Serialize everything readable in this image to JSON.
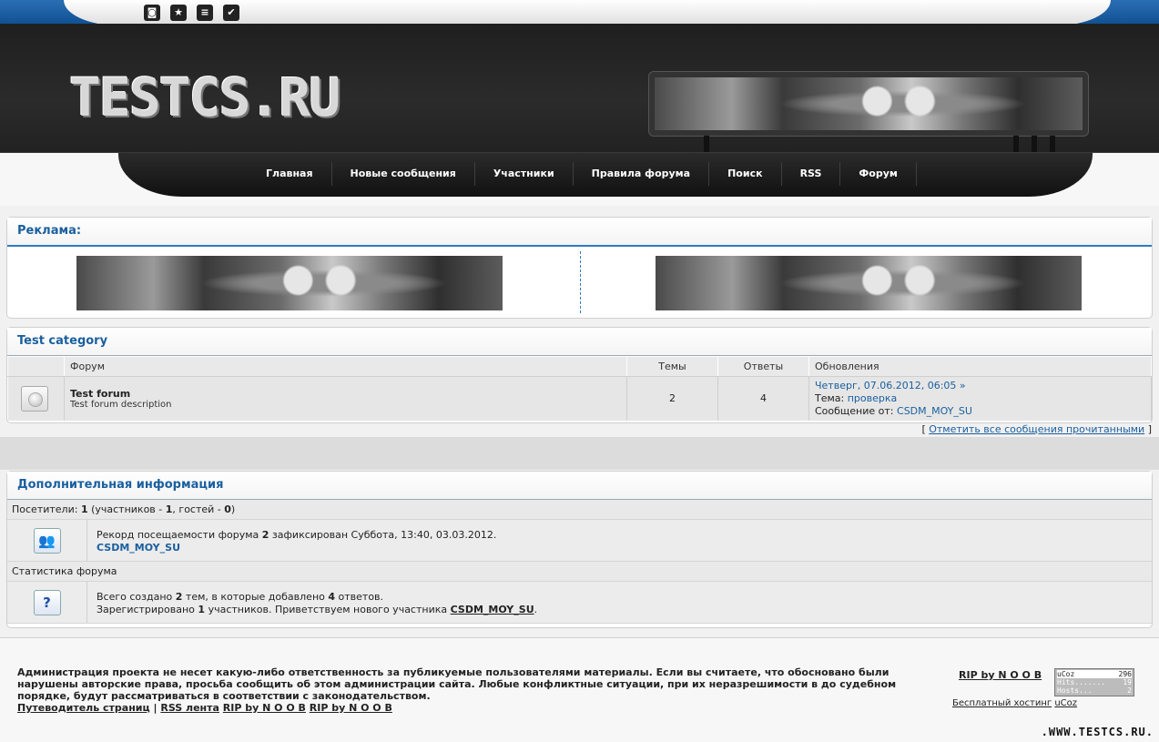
{
  "top_icons": [
    {
      "name": "rss-icon",
      "glyph": "◙"
    },
    {
      "name": "star-icon",
      "glyph": "★"
    },
    {
      "name": "share-icon",
      "glyph": "≡"
    },
    {
      "name": "check-icon",
      "glyph": "✔"
    }
  ],
  "header": {
    "logo": "TESTCS.RU"
  },
  "nav": [
    "Главная",
    "Новые сообщения",
    "Участники",
    "Правила форума",
    "Поиск",
    "RSS",
    "Форум"
  ],
  "ads": {
    "title": "Реклама:"
  },
  "category": {
    "title": "Test category",
    "columns": [
      "Форум",
      "Темы",
      "Ответы",
      "Обновления"
    ],
    "forum": {
      "name": "Test forum",
      "description": "Test forum description",
      "topics": "2",
      "replies": "4",
      "last_date": "Четверг, 07.06.2012, 06:05",
      "last_arrow": "»",
      "topic_label": "Тема:",
      "topic": "проверка",
      "author_label": "Сообщение от:",
      "author": "CSDM_MOY_SU"
    },
    "mark_read_open": "[",
    "mark_read": "Отметить все сообщения прочитанными",
    "mark_read_close": "]"
  },
  "info": {
    "title": "Дополнительная информация",
    "visitors": {
      "label": "Посетители:",
      "total": "1",
      "open": "(участников -",
      "members": "1",
      "mid": ", гостей -",
      "guests": "0",
      "close": ")"
    },
    "record": {
      "prefix": "Рекорд посещаемости форума",
      "count": "2",
      "suffix": "зафиксирован Суббота, 13:40, 03.03.2012.",
      "user": "CSDM_MOY_SU"
    },
    "stats_label": "Статистика форума",
    "stats": {
      "l1_a": "Всего создано",
      "topics": "2",
      "l1_b": "тем, в которые добавлено",
      "replies": "4",
      "l1_c": "ответов.",
      "l2_a": "Зарегистрировано",
      "users": "1",
      "l2_b": "участников. Приветствуем нового участника",
      "newest": "CSDM_MOY_SU",
      "l2_c": "."
    }
  },
  "footer": {
    "disclaimer": "Администрация проекта не несет какую-либо ответственность за публикуемые пользователями материалы. Если вы считаете, что обосновано были нарушены авторские права, просьба сообщить об этом администрации сайта. Любые конфликтные ситуации, при их неразрешимости в до судебном порядке, будут рассматриваться в соответствии с законодательством.",
    "links": [
      "Путеводитель страниц",
      "RSS лента",
      "RIP by N O O B",
      "RIP by N O O B"
    ],
    "sep": "|",
    "rip": "RIP by N O O B",
    "free_hosting": "Бесплатный хостинг",
    "ucoz": "uCoz",
    "counter": {
      "brand": "uCoz",
      "brand_val": "296",
      "hits_label": "Hits.......",
      "hits": "19",
      "hosts_label": "Hosts...",
      "hosts": "2"
    },
    "watermark": ".WWW.TESTCS.RU."
  }
}
